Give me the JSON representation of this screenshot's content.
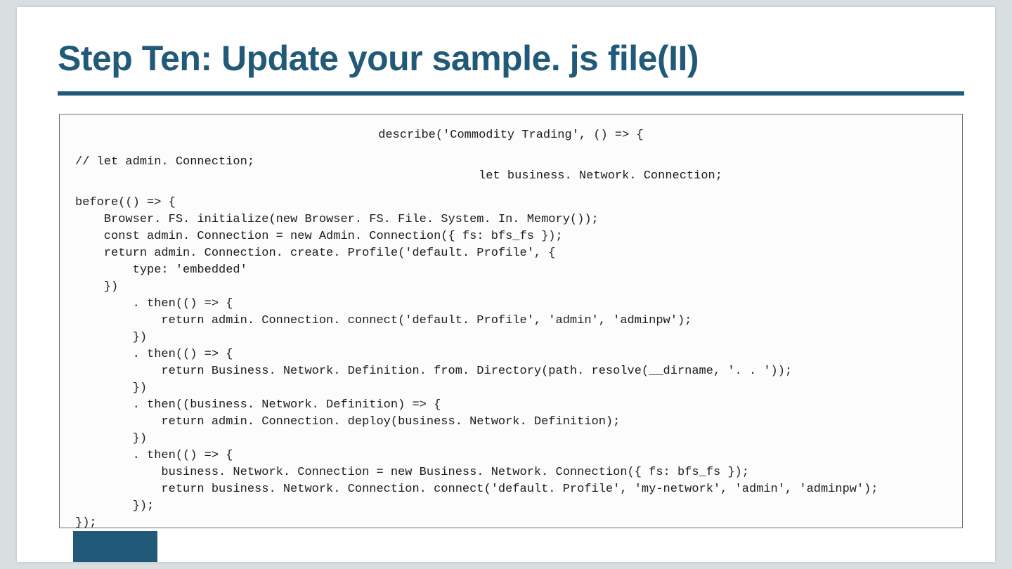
{
  "title": "Step Ten: Update your sample. js file(II)",
  "code": {
    "line1": "describe('Commodity Trading', () => {",
    "line2_left": "// let admin. Connection;",
    "line2_right": "let business. Network. Connection;",
    "body": "before(() => {\n    Browser. FS. initialize(new Browser. FS. File. System. In. Memory());\n    const admin. Connection = new Admin. Connection({ fs: bfs_fs });\n    return admin. Connection. create. Profile('default. Profile', {\n        type: 'embedded'\n    })\n        . then(() => {\n            return admin. Connection. connect('default. Profile', 'admin', 'adminpw');\n        })\n        . then(() => {\n            return Business. Network. Definition. from. Directory(path. resolve(__dirname, '. . '));\n        })\n        . then((business. Network. Definition) => {\n            return admin. Connection. deploy(business. Network. Definition);\n        })\n        . then(() => {\n            business. Network. Connection = new Business. Network. Connection({ fs: bfs_fs });\n            return business. Network. Connection. connect('default. Profile', 'my-network', 'admin', 'adminpw');\n        });\n});"
  }
}
